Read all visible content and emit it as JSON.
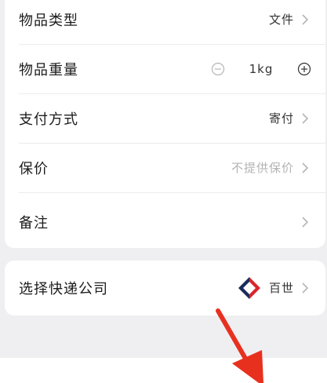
{
  "item_type": {
    "label": "物品类型",
    "value": "文件"
  },
  "item_weight": {
    "label": "物品重量",
    "value": "1kg"
  },
  "payment": {
    "label": "支付方式",
    "value": "寄付"
  },
  "insurance": {
    "label": "保价",
    "value": "不提供保价"
  },
  "remark": {
    "label": "备注"
  },
  "courier": {
    "label": "选择快递公司",
    "value": "百世"
  },
  "colors": {
    "accent_arrow": "#e8301f",
    "logo_red": "#d8262c",
    "logo_navy": "#1b2a5c"
  }
}
